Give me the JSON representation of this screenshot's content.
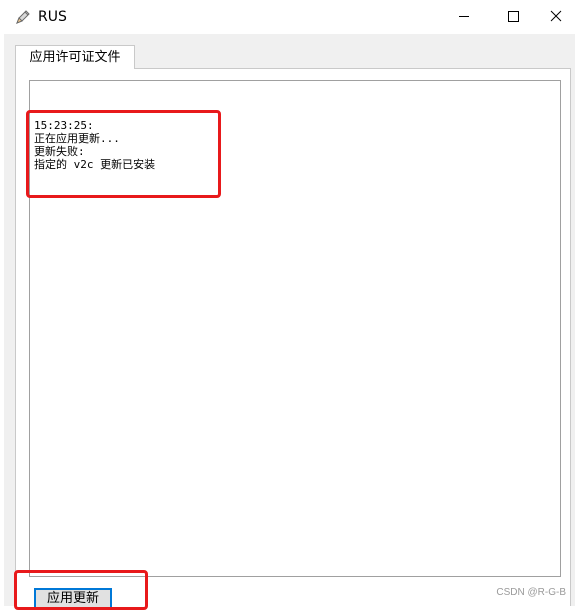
{
  "window": {
    "title": "RUS",
    "icon": "pencil-app-icon"
  },
  "tabs": [
    {
      "label": "应用许可证文件",
      "active": true
    }
  ],
  "log": {
    "lines": [
      "15:23:25:",
      "正在应用更新...",
      "更新失败:",
      "指定的 v2c 更新已安装"
    ]
  },
  "actions": {
    "apply_update_label": "应用更新"
  },
  "watermark": "CSDN @R-G-B",
  "colors": {
    "highlight": "#e8191b",
    "focus_border": "#0078d7",
    "dialog_bg": "#f0f0f0"
  }
}
